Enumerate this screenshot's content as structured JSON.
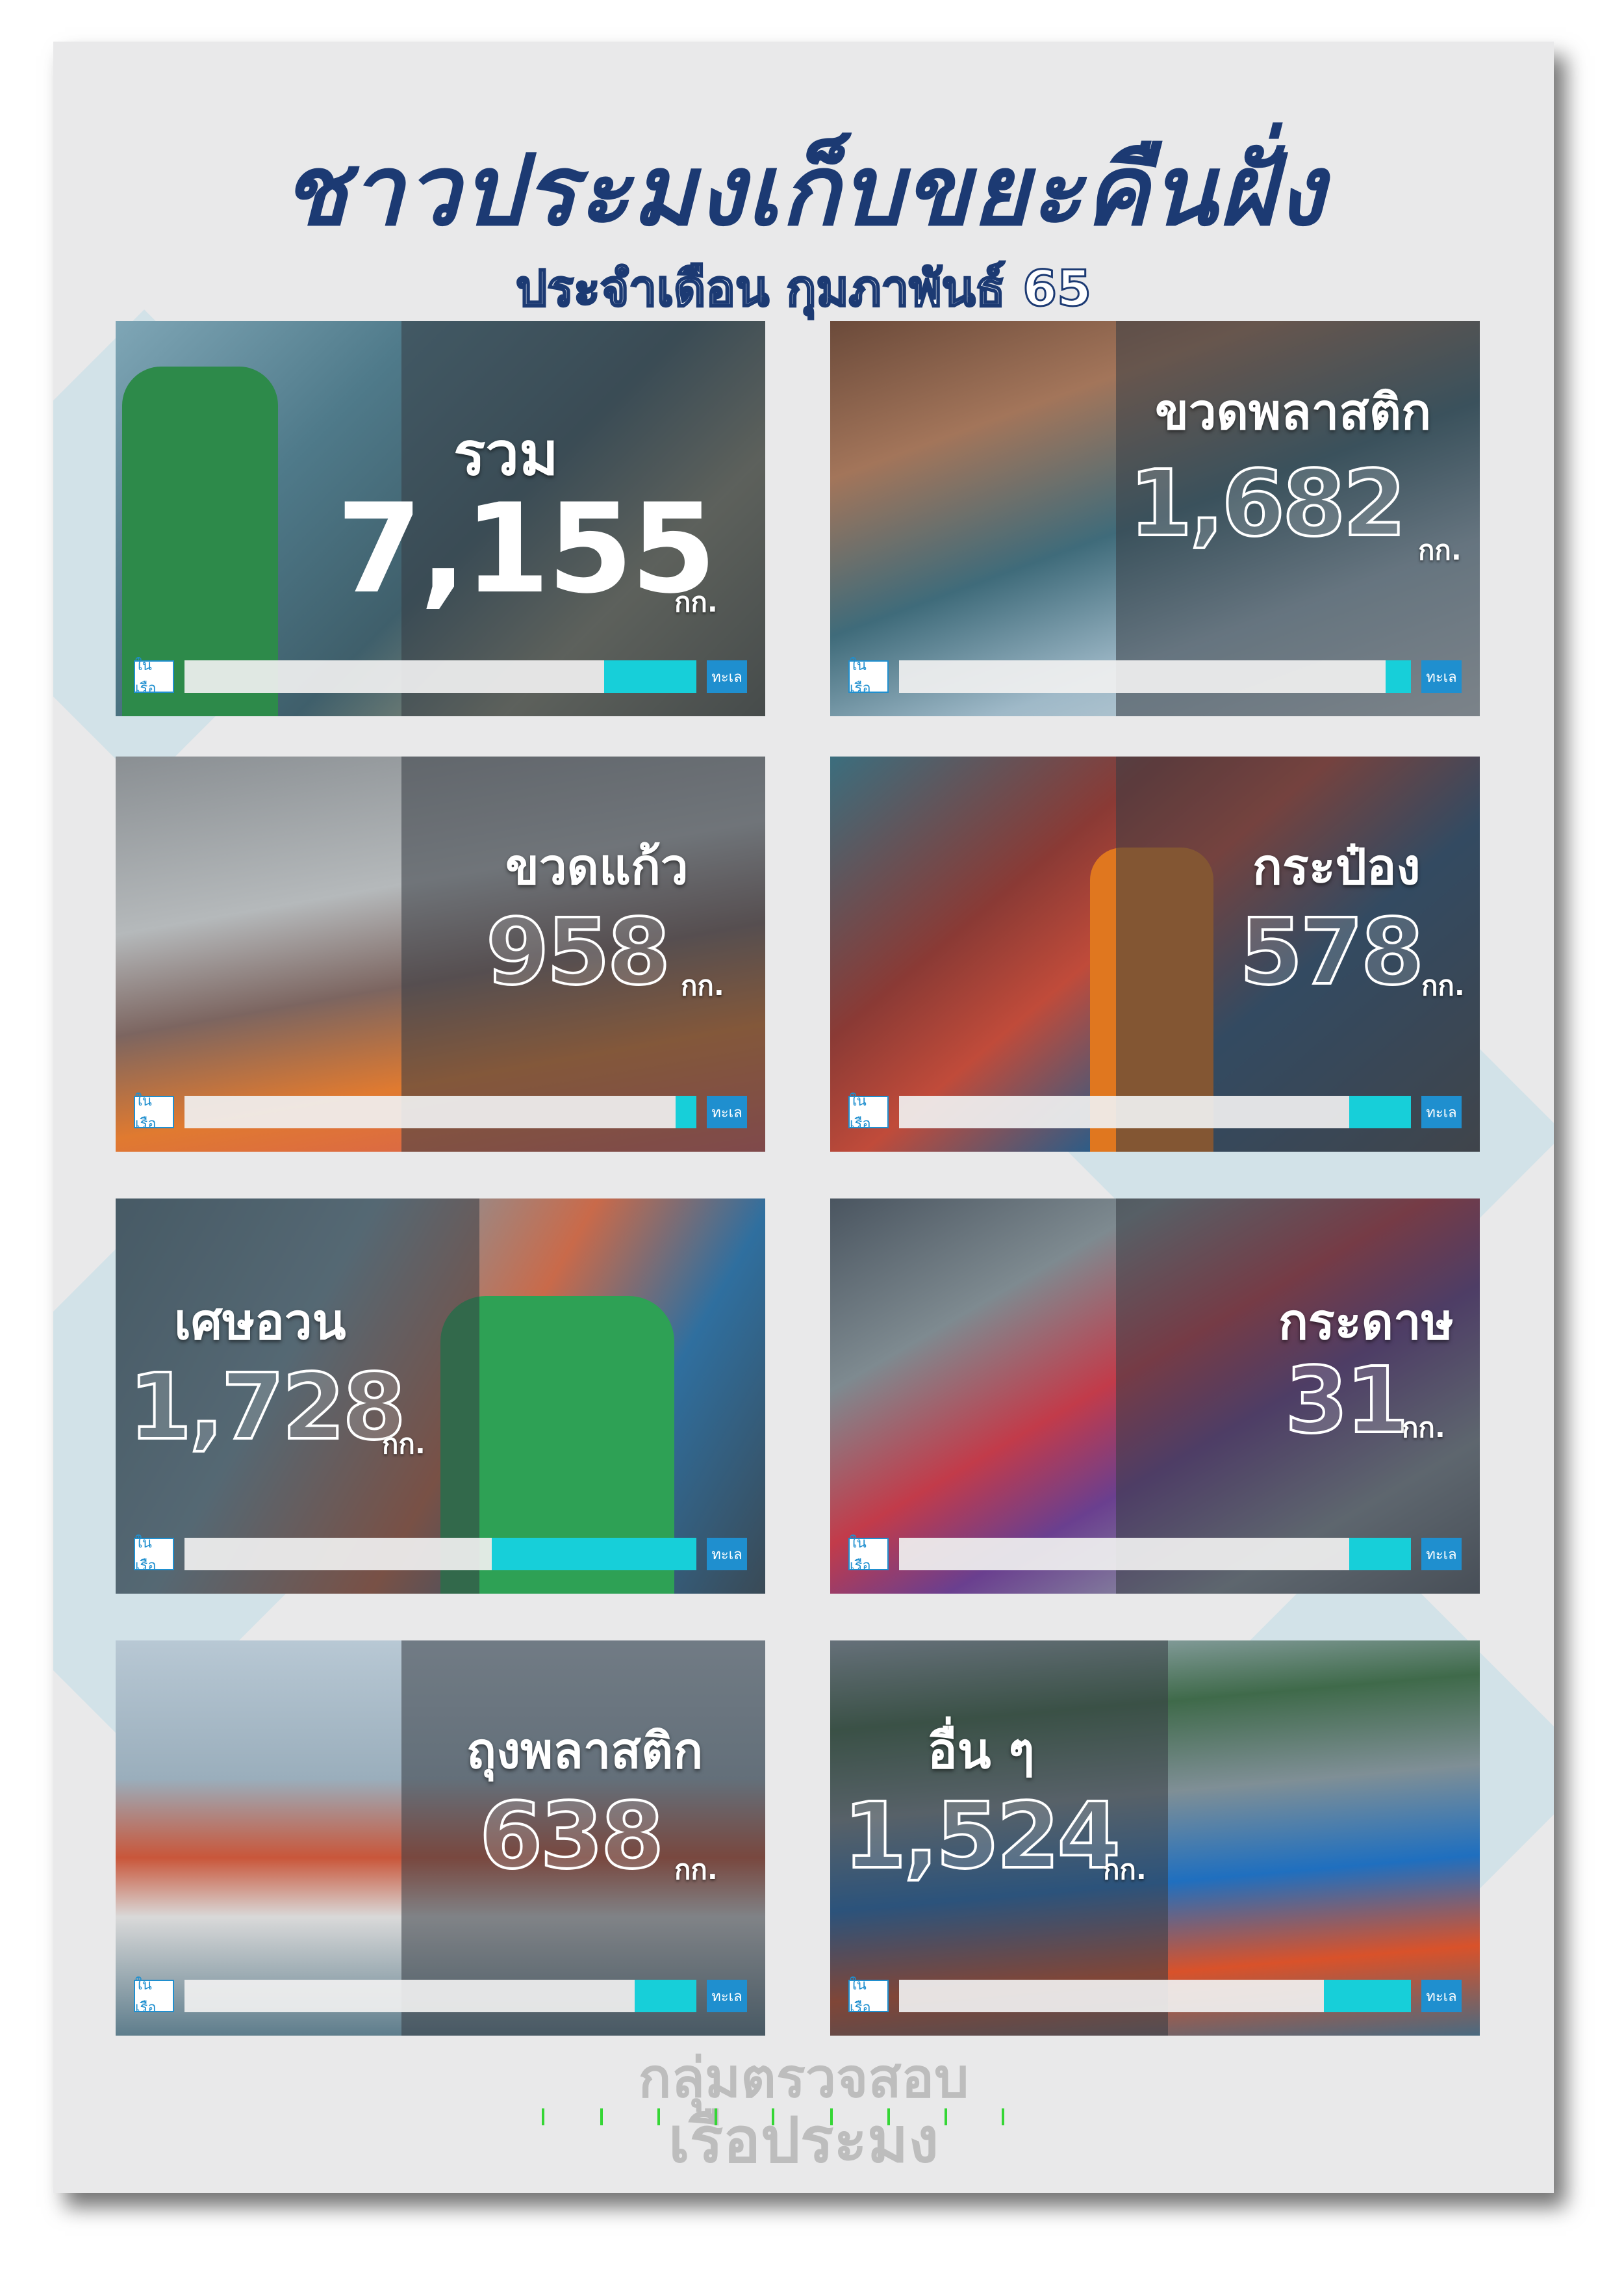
{
  "title": "ชาวประมงเก็บขยะคืนฝั่ง",
  "subtitle": "ประจำเดือน กุมภาพันธ์ 65",
  "bar_labels": {
    "left": "ในเรือ",
    "right": "ทะเล"
  },
  "cards": [
    {
      "label": "รวม",
      "value": "7,155",
      "unit": "กก.",
      "fill": 0.18
    },
    {
      "label": "ขวดพลาสติก",
      "value": "1,682",
      "unit": "กก.",
      "fill": 0.05
    },
    {
      "label": "ขวดแก้ว",
      "value": "958",
      "unit": "กก.",
      "fill": 0.04
    },
    {
      "label": "กระป๋อง",
      "value": "578",
      "unit": "กก.",
      "fill": 0.12
    },
    {
      "label": "เศษอวน",
      "value": "1,728",
      "unit": "กก.",
      "fill": 0.4
    },
    {
      "label": "กระดาษ",
      "value": "31",
      "unit": "กก.",
      "fill": 0.12
    },
    {
      "label": "ถุงพลาสติก",
      "value": "638",
      "unit": "กก.",
      "fill": 0.12
    },
    {
      "label": "อื่น ๆ",
      "value": "1,524",
      "unit": "กก.",
      "fill": 0.17
    }
  ],
  "logo": {
    "line1": "กลุ่มตรวจสอบ",
    "line2": "เรือประมง"
  },
  "colors": {
    "title": "#1c3a73",
    "bar_fill": "#17cfd9",
    "bar_end": "#1f8fcf",
    "logo": "#bdbdbd"
  }
}
